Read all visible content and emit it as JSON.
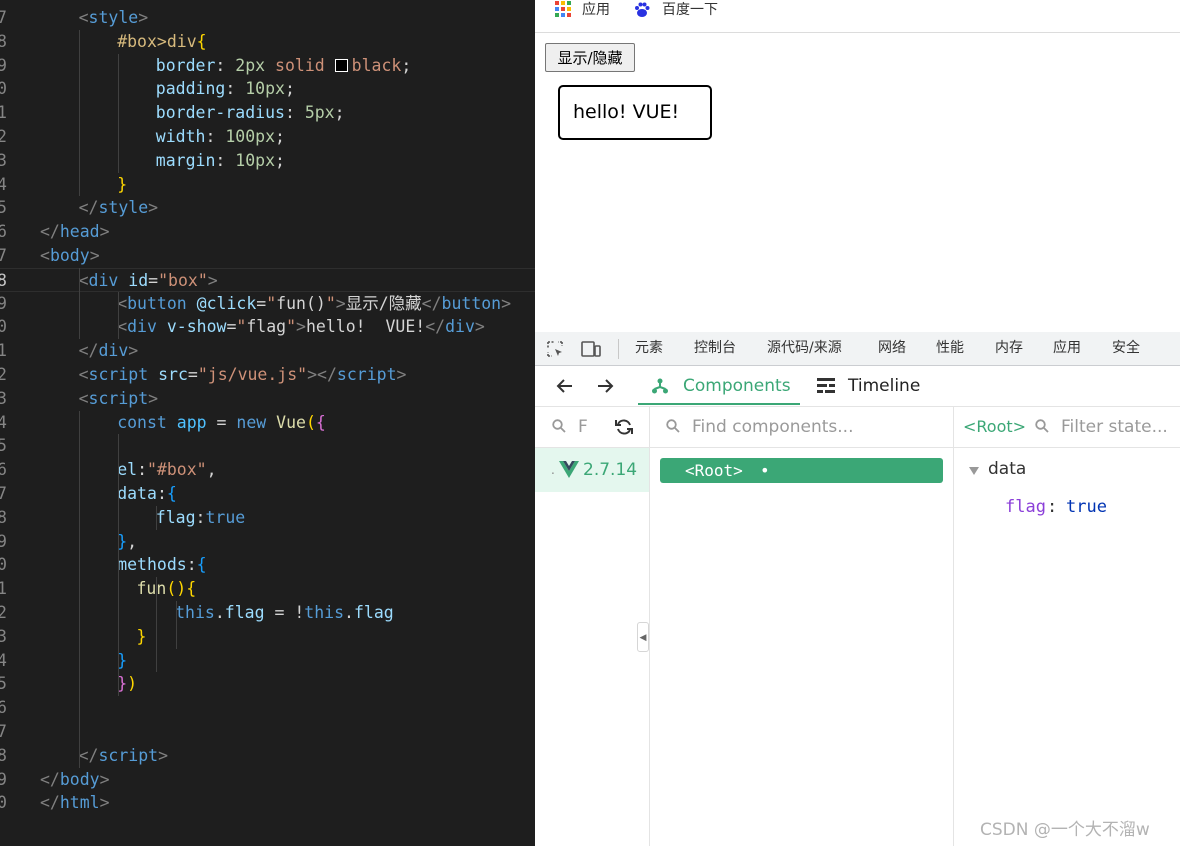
{
  "editor": {
    "line_numbers": [
      "7",
      "8",
      "9",
      "0",
      "1",
      "2",
      "3",
      "4",
      "5",
      "6",
      "7",
      "8",
      "9",
      "0",
      "1",
      "2",
      "3",
      "4",
      "5",
      "6",
      "7",
      "8",
      "9",
      "0",
      "1",
      "2",
      "3",
      "4",
      "5",
      "6",
      "7",
      "8",
      "9",
      "0"
    ],
    "lines": [
      [
        [
          "t-br",
          "<"
        ],
        [
          "t-tag",
          "style"
        ],
        [
          "t-br",
          ">"
        ]
      ],
      [
        [
          "t-sel",
          "#box>div"
        ],
        [
          "t-p1",
          "{"
        ]
      ],
      [
        [
          "t-prop",
          "border"
        ],
        [
          "t-plain",
          ": "
        ],
        [
          "t-num",
          "2px"
        ],
        [
          "t-val",
          " solid "
        ],
        [
          "swatch",
          ""
        ],
        [
          "t-val",
          "black"
        ],
        [
          "t-plain",
          ";"
        ]
      ],
      [
        [
          "t-prop",
          "padding"
        ],
        [
          "t-plain",
          ": "
        ],
        [
          "t-num",
          "10px"
        ],
        [
          "t-plain",
          ";"
        ]
      ],
      [
        [
          "t-prop",
          "border-radius"
        ],
        [
          "t-plain",
          ": "
        ],
        [
          "t-num",
          "5px"
        ],
        [
          "t-plain",
          ";"
        ]
      ],
      [
        [
          "t-prop",
          "width"
        ],
        [
          "t-plain",
          ": "
        ],
        [
          "t-num",
          "100px"
        ],
        [
          "t-plain",
          ";"
        ]
      ],
      [
        [
          "t-prop",
          "margin"
        ],
        [
          "t-plain",
          ": "
        ],
        [
          "t-num",
          "10px"
        ],
        [
          "t-plain",
          ";"
        ]
      ],
      [
        [
          "t-p1",
          "}"
        ]
      ],
      [
        [
          "t-br",
          "</"
        ],
        [
          "t-tag",
          "style"
        ],
        [
          "t-br",
          ">"
        ]
      ],
      [
        [
          "t-br",
          "</"
        ],
        [
          "t-tag",
          "head"
        ],
        [
          "t-br",
          ">"
        ]
      ],
      [
        [
          "t-br",
          "<"
        ],
        [
          "t-tag",
          "body"
        ],
        [
          "t-br",
          ">"
        ]
      ],
      [
        [
          "t-br",
          "<"
        ],
        [
          "t-tag",
          "div"
        ],
        [
          "t-plain",
          " "
        ],
        [
          "t-attr",
          "id"
        ],
        [
          "t-plain",
          "="
        ],
        [
          "t-str",
          "\"box\""
        ],
        [
          "t-br",
          ">"
        ]
      ],
      [
        [
          "t-br",
          "<"
        ],
        [
          "t-tag",
          "button"
        ],
        [
          "t-plain",
          " "
        ],
        [
          "t-attr",
          "@click"
        ],
        [
          "t-plain",
          "="
        ],
        [
          "t-str",
          "\""
        ],
        [
          "t-plain",
          "fun()"
        ],
        [
          "t-str",
          "\""
        ],
        [
          "t-br",
          ">"
        ],
        [
          "t-plain",
          "显示/隐藏"
        ],
        [
          "t-br",
          "</"
        ],
        [
          "t-tag",
          "button"
        ],
        [
          "t-br",
          ">"
        ]
      ],
      [
        [
          "t-br",
          "<"
        ],
        [
          "t-tag",
          "div"
        ],
        [
          "t-plain",
          " "
        ],
        [
          "t-attr",
          "v-show"
        ],
        [
          "t-plain",
          "="
        ],
        [
          "t-str",
          "\""
        ],
        [
          "t-plain",
          "flag"
        ],
        [
          "t-str",
          "\""
        ],
        [
          "t-br",
          ">"
        ],
        [
          "t-plain",
          "hello!  VUE!"
        ],
        [
          "t-br",
          "</"
        ],
        [
          "t-tag",
          "div"
        ],
        [
          "t-br",
          ">"
        ]
      ],
      [
        [
          "t-br",
          "</"
        ],
        [
          "t-tag",
          "div"
        ],
        [
          "t-br",
          ">"
        ]
      ],
      [
        [
          "t-br",
          "<"
        ],
        [
          "t-tag",
          "script"
        ],
        [
          "t-plain",
          " "
        ],
        [
          "t-attr",
          "src"
        ],
        [
          "t-plain",
          "="
        ],
        [
          "t-str",
          "\"js/vue.js\""
        ],
        [
          "t-br",
          "></"
        ],
        [
          "t-tag",
          "script"
        ],
        [
          "t-br",
          ">"
        ]
      ],
      [
        [
          "t-br",
          "<"
        ],
        [
          "t-tag",
          "script"
        ],
        [
          "t-br",
          ">"
        ]
      ],
      [
        [
          "t-kw",
          "const"
        ],
        [
          "t-plain",
          " "
        ],
        [
          "t-var",
          "app"
        ],
        [
          "t-plain",
          " = "
        ],
        [
          "t-kw",
          "new"
        ],
        [
          "t-plain",
          " "
        ],
        [
          "t-fn",
          "Vue"
        ],
        [
          "t-p1",
          "("
        ],
        [
          "t-p2",
          "{"
        ]
      ],
      [],
      [
        [
          "t-prop",
          "el"
        ],
        [
          "t-plain",
          ":"
        ],
        [
          "t-str",
          "\"#box\""
        ],
        [
          "t-plain",
          ","
        ]
      ],
      [
        [
          "t-prop",
          "data"
        ],
        [
          "t-plain",
          ":"
        ],
        [
          "t-p3",
          "{"
        ]
      ],
      [
        [
          "t-prop",
          "flag"
        ],
        [
          "t-plain",
          ":"
        ],
        [
          "t-kw",
          "true"
        ]
      ],
      [
        [
          "t-p3",
          "}"
        ],
        [
          "t-plain",
          ","
        ]
      ],
      [
        [
          "t-prop",
          "methods"
        ],
        [
          "t-plain",
          ":"
        ],
        [
          "t-p3",
          "{"
        ]
      ],
      [
        [
          "t-fn",
          "fun"
        ],
        [
          "t-p1",
          "()"
        ],
        [
          "t-p1",
          "{"
        ]
      ],
      [
        [
          "t-this",
          "this"
        ],
        [
          "t-plain",
          "."
        ],
        [
          "t-prop",
          "flag"
        ],
        [
          "t-plain",
          " = !"
        ],
        [
          "t-this",
          "this"
        ],
        [
          "t-plain",
          "."
        ],
        [
          "t-prop",
          "flag"
        ]
      ],
      [
        [
          "t-p1",
          "}"
        ]
      ],
      [
        [
          "t-p3",
          "}"
        ]
      ],
      [
        [
          "t-p2",
          "}"
        ],
        [
          "t-p1",
          ")"
        ]
      ],
      [],
      [],
      [
        [
          "t-br",
          "</"
        ],
        [
          "t-tag",
          "script"
        ],
        [
          "t-br",
          ">"
        ]
      ],
      [
        [
          "t-br",
          "</"
        ],
        [
          "t-tag",
          "body"
        ],
        [
          "t-br",
          ">"
        ]
      ],
      [
        [
          "t-br",
          "</"
        ],
        [
          "t-tag",
          "html"
        ],
        [
          "t-br",
          ">"
        ]
      ]
    ]
  },
  "browser": {
    "bookmarks": {
      "apps": "应用",
      "baidu": "百度一下"
    },
    "toggle_button": "显示/隐藏",
    "hello_text": "hello! VUE!"
  },
  "devtools": {
    "tabs": [
      "元素",
      "控制台",
      "源代码/来源",
      "网络",
      "性能",
      "内存",
      "应用",
      "安全"
    ],
    "vue_tabs": {
      "components": "Components",
      "timeline": "Timeline"
    },
    "apps_search_placeholder": "F",
    "app_version": "2.7.14",
    "find_components_placeholder": "Find components...",
    "root_node": "<Root>",
    "root_dot": "•",
    "inspector_root": "<Root>",
    "filter_state_placeholder": "Filter state...",
    "state_section": "data",
    "state_key": "flag",
    "state_value": "true"
  },
  "watermark": "CSDN @一个大不溜w",
  "colors": {
    "vue_green": "#3ba776",
    "editor_bg": "#1e1e1e"
  }
}
